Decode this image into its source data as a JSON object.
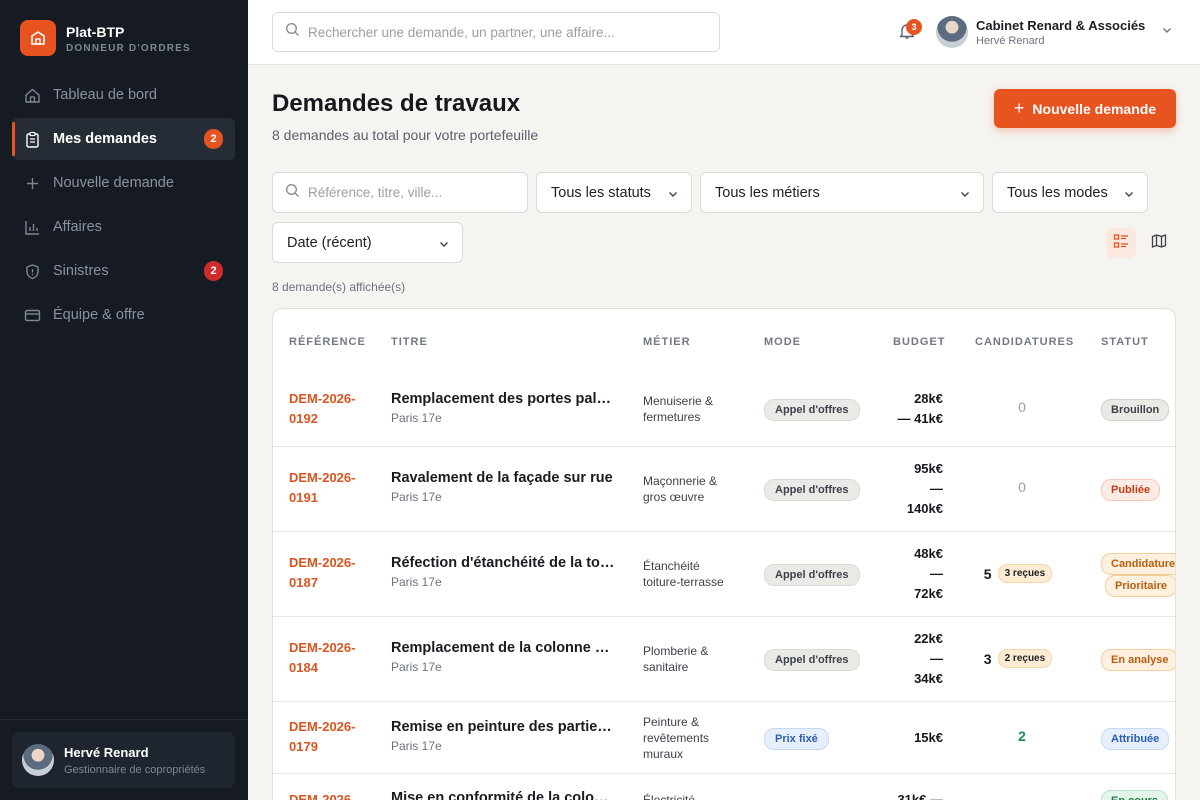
{
  "brand": {
    "name": "Plat-BTP",
    "subtitle": "DONNEUR D'ORDRES"
  },
  "sidebar": {
    "items": [
      {
        "label": "Tableau de bord",
        "icon": "home-icon"
      },
      {
        "label": "Mes demandes",
        "icon": "clipboard-icon",
        "badge": "2",
        "active": true
      },
      {
        "label": "Nouvelle demande",
        "icon": "plus-icon"
      },
      {
        "label": "Affaires",
        "icon": "bar-chart-icon"
      },
      {
        "label": "Sinistres",
        "icon": "shield-icon",
        "badge": "2"
      },
      {
        "label": "Équipe & offre",
        "icon": "card-icon"
      }
    ],
    "user": {
      "name": "Hervé Renard",
      "role": "Gestionnaire de copropriétés"
    }
  },
  "topbar": {
    "search_placeholder": "Rechercher une demande, un partner, une affaire...",
    "notifications_count": "3",
    "org": "Cabinet Renard & Associés",
    "user": "Hervé Renard"
  },
  "header": {
    "title": "Demandes de travaux",
    "subtitle": "8 demandes au total pour votre portefeuille",
    "new_button": "Nouvelle demande"
  },
  "filters": {
    "search_placeholder": "Référence, titre, ville...",
    "status": "Tous les statuts",
    "metier": "Tous les métiers",
    "mode": "Tous les modes",
    "sort": "Date (récent)"
  },
  "count_text": "8 demande(s) affichée(s)",
  "table": {
    "headers": [
      "RÉFÉRENCE",
      "TITRE",
      "MÉTIER",
      "MODE",
      "BUDGET",
      "CANDIDATURES",
      "STATUT"
    ],
    "rows": [
      {
        "ref1": "DEM-2026-",
        "ref2": "0192",
        "title": "Remplacement des portes palières",
        "city": "Paris 17e",
        "metier": "Menuiserie & fermetures",
        "mode": "Appel d'offres",
        "budget": [
          "28k€",
          "— 41k€"
        ],
        "cand": "0",
        "recues": "",
        "status": [
          "Brouillon"
        ]
      },
      {
        "ref1": "DEM-2026-",
        "ref2": "0191",
        "title": "Ravalement de la façade sur rue",
        "city": "Paris 17e",
        "metier": "Maçonnerie & gros œuvre",
        "mode": "Appel d'offres",
        "budget": [
          "95k€",
          "—",
          "140k€"
        ],
        "cand": "0",
        "recues": "",
        "status": [
          "Publiée"
        ]
      },
      {
        "ref1": "DEM-2026-",
        "ref2": "0187",
        "title": "Réfection d'étanchéité de la toiture-terrasse",
        "city": "Paris 17e",
        "metier": "Étanchéité toiture-terrasse",
        "mode": "Appel d'offres",
        "budget": [
          "48k€",
          "—",
          "72k€"
        ],
        "cand": "5",
        "recues": "3 reçues",
        "status": [
          "Candidatures",
          "Prioritaire"
        ]
      },
      {
        "ref1": "DEM-2026-",
        "ref2": "0184",
        "title": "Remplacement de la colonne d'eau",
        "city": "Paris 17e",
        "metier": "Plomberie & sanitaire",
        "mode": "Appel d'offres",
        "budget": [
          "22k€",
          "—",
          "34k€"
        ],
        "cand": "3",
        "recues": "2 reçues",
        "status": [
          "En analyse"
        ]
      },
      {
        "ref1": "DEM-2026-",
        "ref2": "0179",
        "title": "Remise en peinture des parties communes",
        "city": "Paris 17e",
        "metier": "Peinture & revêtements muraux",
        "mode": "Prix fixé",
        "budget": [
          "15k€"
        ],
        "cand": "2",
        "recues": "",
        "status": [
          "Attribuée"
        ]
      },
      {
        "ref1": "DEM-2026-",
        "ref2": "",
        "title": "Mise en conformité de la colonne",
        "city": "",
        "metier": "Électricité",
        "mode": "",
        "budget": [
          "31k€ —"
        ],
        "cand": "",
        "recues": "",
        "status": [
          "En cours"
        ]
      }
    ]
  },
  "colors": {
    "accent": "#e8541f",
    "sidebar_bg": "#161b23"
  }
}
